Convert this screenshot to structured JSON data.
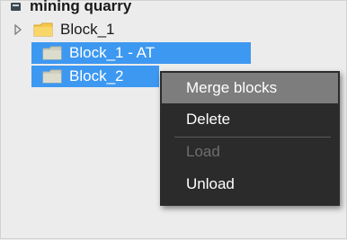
{
  "tree": {
    "root": {
      "label": "mining quarry",
      "icon": "database-icon"
    },
    "items": [
      {
        "label": "Block_1",
        "icon": "folder-icon",
        "color": "#f4c84a",
        "expandable": true,
        "selected": false
      },
      {
        "label": "Block_1 - AT",
        "icon": "folder-icon",
        "color": "#d8d8c8",
        "expandable": false,
        "selected": true
      },
      {
        "label": "Block_2",
        "icon": "folder-icon",
        "color": "#d8d8c8",
        "expandable": false,
        "selected": true
      }
    ],
    "selection_color": "#3d98f1"
  },
  "context_menu": {
    "items": [
      {
        "label": "Merge blocks",
        "state": "highlighted"
      },
      {
        "label": "Delete",
        "state": "enabled"
      },
      {
        "label": "Load",
        "state": "disabled"
      },
      {
        "label": "Unload",
        "state": "enabled"
      }
    ],
    "background": "#2b2b2b",
    "highlight": "#7d7d7d"
  }
}
